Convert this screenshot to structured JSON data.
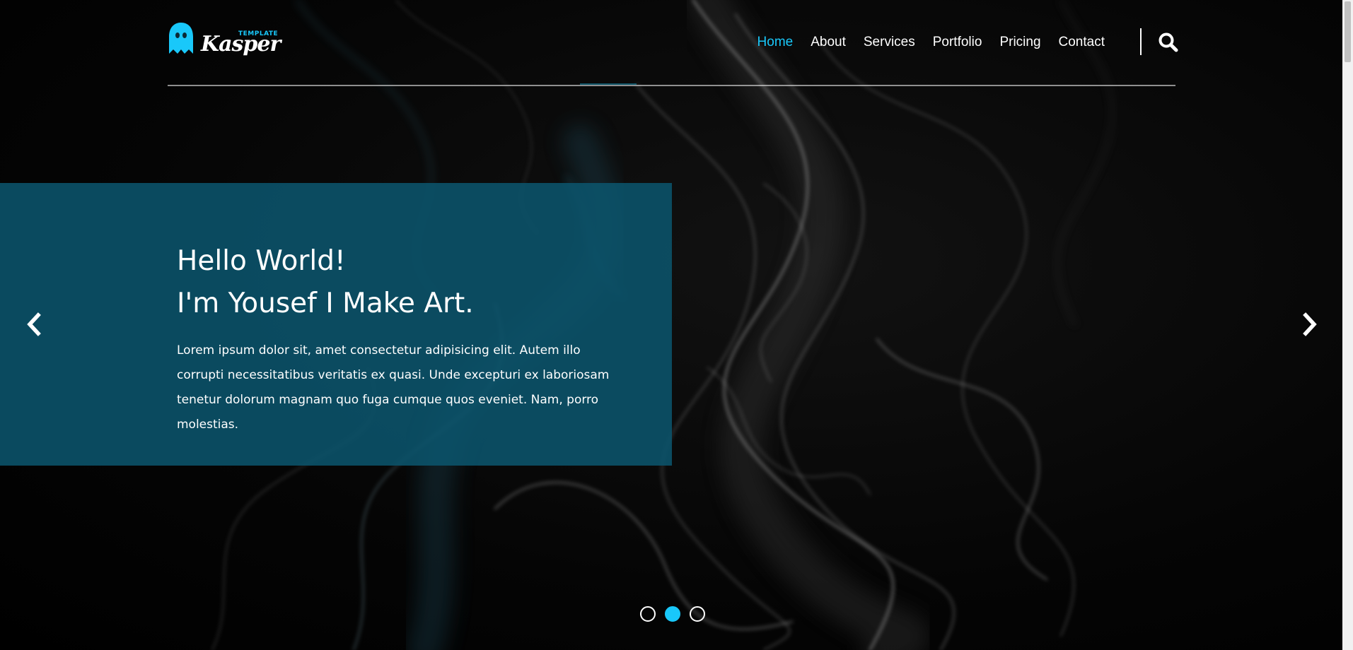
{
  "brand": {
    "small": "TEMPLATE",
    "word": "Kasper",
    "accent": "#19c8fa"
  },
  "nav": {
    "items": [
      {
        "label": "Home",
        "active": true
      },
      {
        "label": "About",
        "active": false
      },
      {
        "label": "Services",
        "active": false
      },
      {
        "label": "Portfolio",
        "active": false
      },
      {
        "label": "Pricing",
        "active": false
      },
      {
        "label": "Contact",
        "active": false
      }
    ]
  },
  "hero": {
    "line1": "Hello World!",
    "line2": "I'm Yousef I Make Art.",
    "lead": "Lorem ipsum dolor sit, amet consectetur adipisicing elit. Autem illo corrupti necessitatibus veritatis ex quasi. Unde excepturi ex laboriosam tenetur dolorum magnam quo fuga cumque quos eveniet. Nam, porro molestias.",
    "panel_color": "#0b546c"
  },
  "slider": {
    "prev_icon": "chevron-left-icon",
    "next_icon": "chevron-right-icon",
    "active_slide": 2,
    "total_slides": 3
  },
  "icons": {
    "search": "search-icon",
    "logo": "ghost-icon"
  }
}
